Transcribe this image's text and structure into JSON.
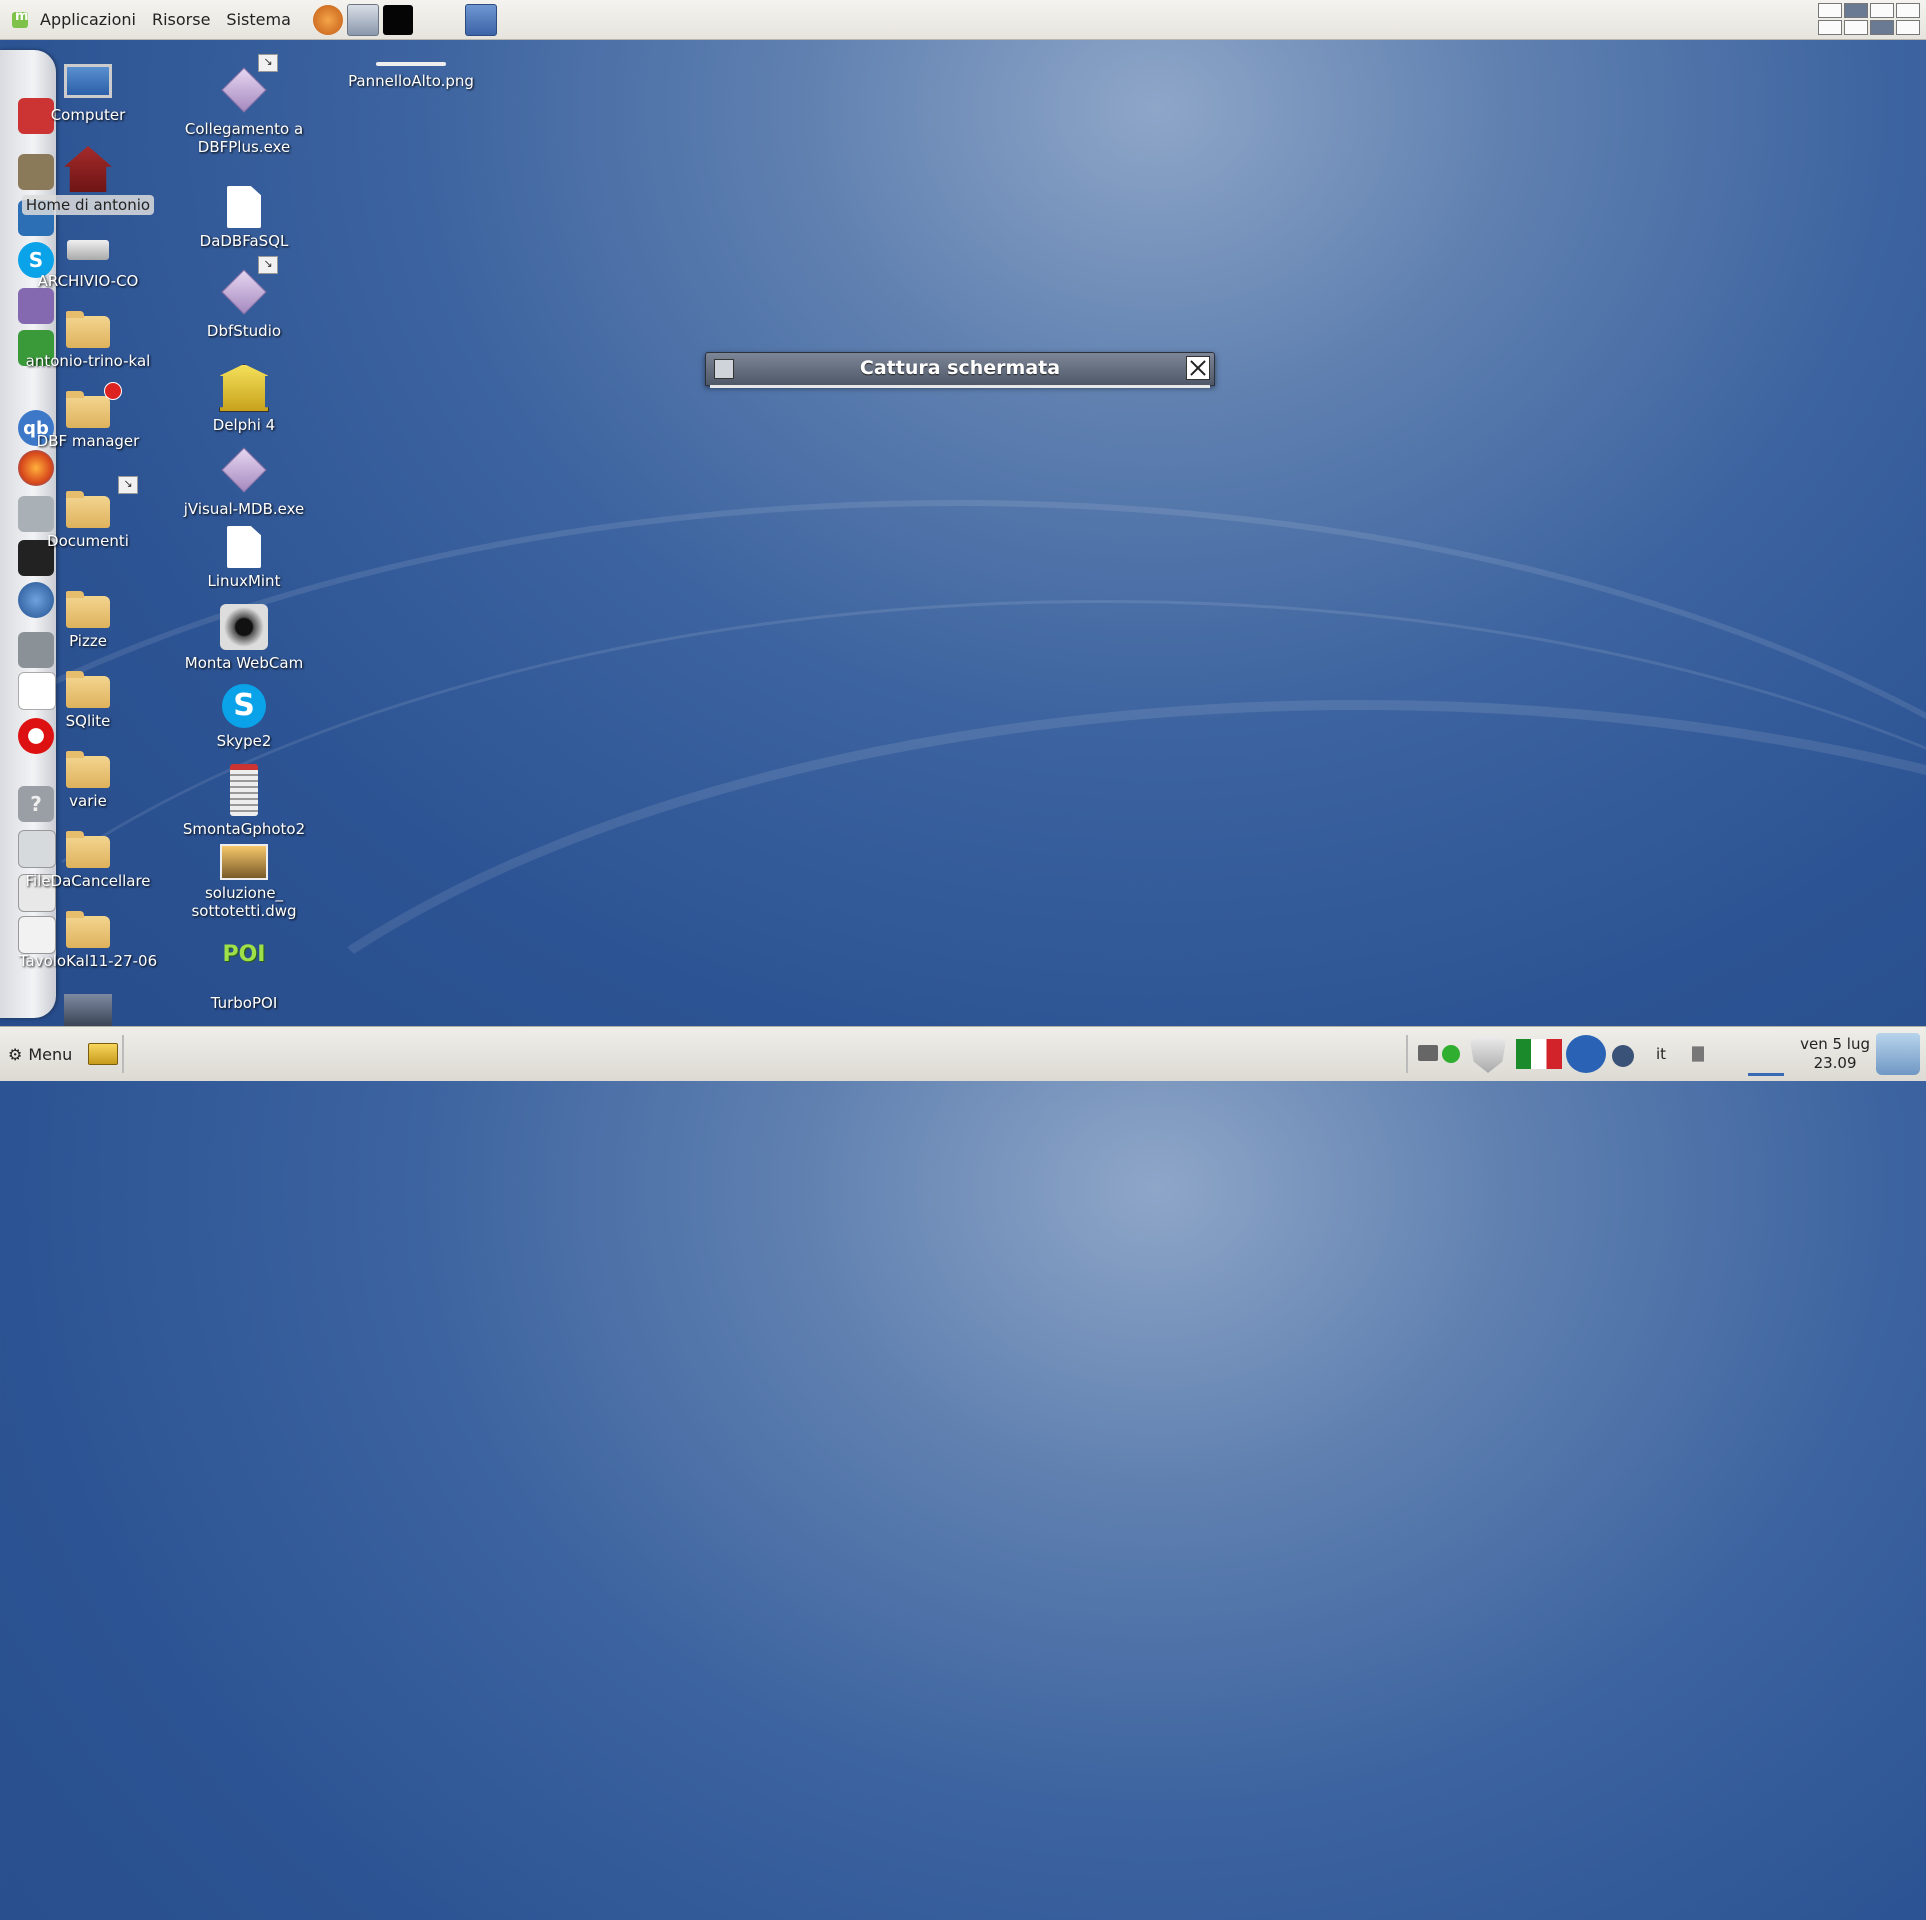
{
  "top_panel": {
    "menus": [
      "Applicazioni",
      "Risorse",
      "Sistema"
    ]
  },
  "desktop": {
    "column1": [
      "Computer",
      "Home di antonio",
      "ARCHIVIO-CO",
      "antonio-trino-kal",
      "DBF manager",
      "Documenti",
      "Pizze",
      "SQlite",
      "varie",
      "FileDaCancellare",
      "TavoloKal11-27-06"
    ],
    "column2": [
      "Collegamento a DBFPlus.exe",
      "DaDBFaSQL",
      "DbfStudio",
      "Delphi 4",
      "jVisual-MDB.exe",
      "LinuxMint",
      "Monta WebCam",
      "Skype2",
      "SmontaGphoto2",
      "soluzione_ sottotetti.dwg",
      "TurboPOI"
    ],
    "loose": [
      "PannelloAlto.png"
    ]
  },
  "dialog": {
    "title": "Cattura schermata"
  },
  "bottom_panel": {
    "menu_label": "Menu",
    "keyboard_layout": "it",
    "clock_date": "ven  5 lug",
    "clock_time": "23.09"
  }
}
